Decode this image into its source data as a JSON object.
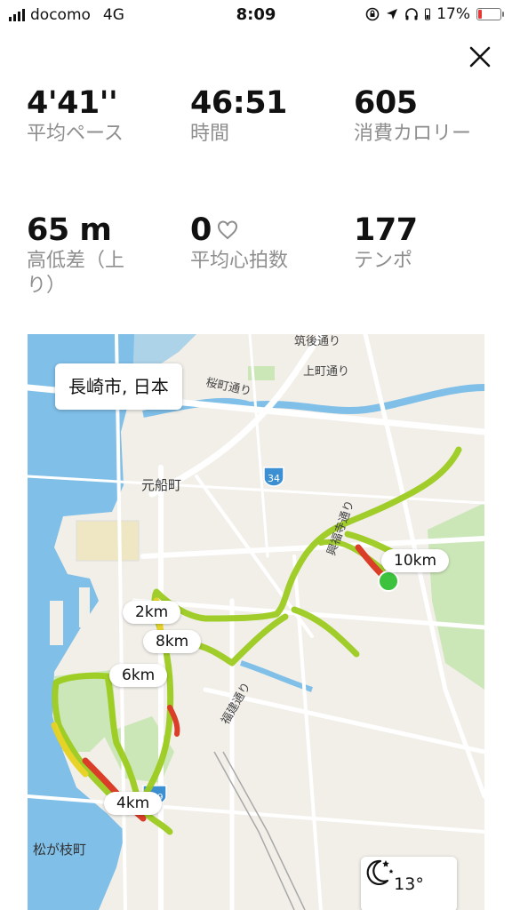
{
  "status_bar": {
    "carrier": "docomo",
    "network": "4G",
    "time": "8:09",
    "battery": "17%"
  },
  "stats": {
    "pace": {
      "value": "4'41''",
      "label": "平均ペース"
    },
    "duration": {
      "value": "46:51",
      "label": "時間"
    },
    "calories": {
      "value": "605",
      "label": "消費カロリー"
    },
    "elevation": {
      "value": "65 m",
      "label": "高低差（上り）"
    },
    "heart_rate": {
      "value": "0",
      "label": "平均心拍数"
    },
    "cadence": {
      "value": "177",
      "label": "テンポ"
    }
  },
  "map": {
    "location": "長崎市, 日本",
    "markers": [
      "2km",
      "4km",
      "6km",
      "8km",
      "10km"
    ],
    "labels": {
      "motofunamachi": "元船町",
      "matsugaemachi": "松が枝町",
      "sakuramachi": "桜町通り",
      "chikugo": "筑後通り",
      "kamimachi": "上町通り",
      "kofukuji": "興福寺通り",
      "fukken": "福建通り",
      "route34": "34",
      "route499": "499"
    },
    "colors": {
      "water": "#7fbfe8",
      "park": "#cbe6b7",
      "route_green": "#9ccc1f",
      "route_yellow": "#e8d21f",
      "route_red": "#d9351f",
      "start": "#3cc23c",
      "finish": "#e31b1b"
    }
  },
  "weather": {
    "temperature": "13°",
    "icon": "moon-stars-icon"
  }
}
